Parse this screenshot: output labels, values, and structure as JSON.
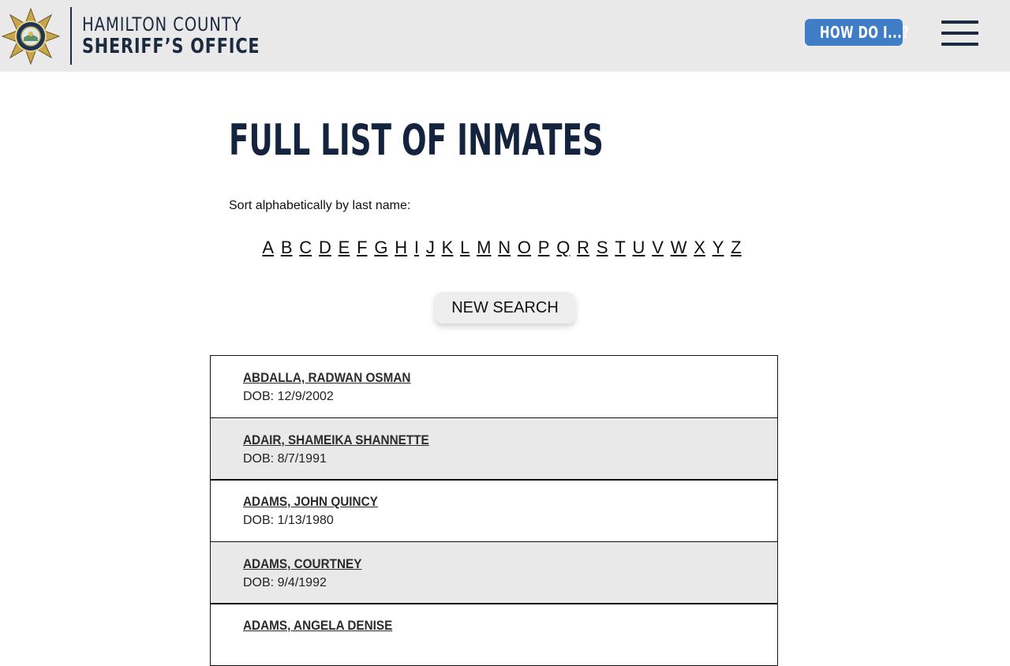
{
  "header": {
    "brand_line1": "HAMILTON COUNTY",
    "brand_line2": "SHERIFF’S OFFICE",
    "how_do_i_label": "HOW DO I...?",
    "colors": {
      "background": "#e9e9e9",
      "navy": "#1c2a40",
      "button_blue": "#3f7ec7"
    }
  },
  "main": {
    "title": "FULL LIST OF INMATES",
    "sort_label": "Sort alphabetically by last name:",
    "alphabet": [
      "A",
      "B",
      "C",
      "D",
      "E",
      "F",
      "G",
      "H",
      "I",
      "J",
      "K",
      "L",
      "M",
      "N",
      "O",
      "P",
      "Q",
      "R",
      "S",
      "T",
      "U",
      "V",
      "W",
      "X",
      "Y",
      "Z"
    ],
    "new_search_label": "NEW SEARCH",
    "dob_prefix": "DOB:",
    "inmates": [
      {
        "name": "ABDALLA, RADWAN OSMAN",
        "dob": "12/9/2002"
      },
      {
        "name": "ADAIR, SHAMEIKA SHANNETTE",
        "dob": "8/7/1991"
      },
      {
        "name": "ADAMS, JOHN QUINCY",
        "dob": "1/13/1980"
      },
      {
        "name": "ADAMS, COURTNEY",
        "dob": "9/4/1992"
      },
      {
        "name": "ADAMS, ANGELA DENISE",
        "dob": ""
      }
    ]
  }
}
